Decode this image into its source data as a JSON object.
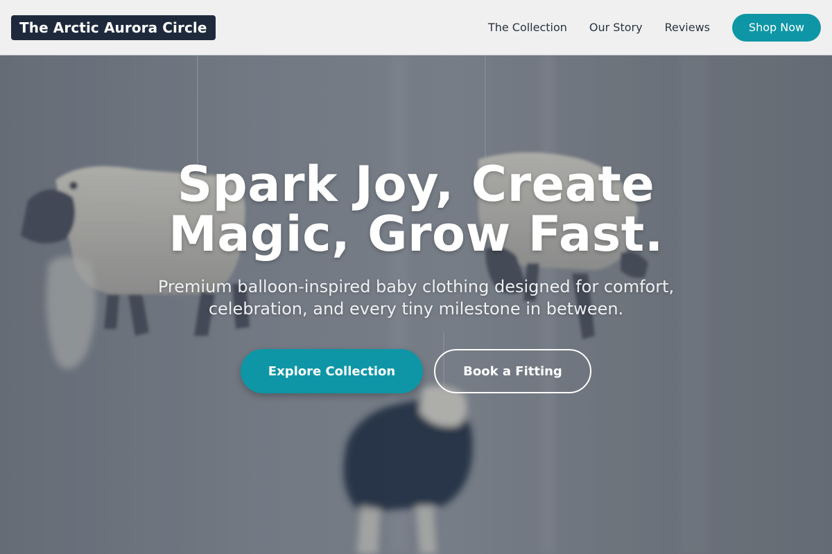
{
  "header": {
    "brand": "The Arctic Aurora Circle",
    "nav": [
      "The Collection",
      "Our Story",
      "Reviews"
    ],
    "cta": "Shop Now"
  },
  "hero": {
    "headline": "Spark Joy, Create Magic, Grow Fast.",
    "subtitle": "Premium balloon-inspired baby clothing designed for comfort, celebration, and every tiny milestone in between.",
    "primary_cta": "Explore Collection",
    "secondary_cta": "Book a Fitting",
    "background": "blurred photo of knitted toy sheep hanging from a mobile"
  },
  "colors": {
    "accent": "#0e96a6",
    "brand_bg": "#1e2a3c",
    "header_bg": "#f0f0f0"
  }
}
